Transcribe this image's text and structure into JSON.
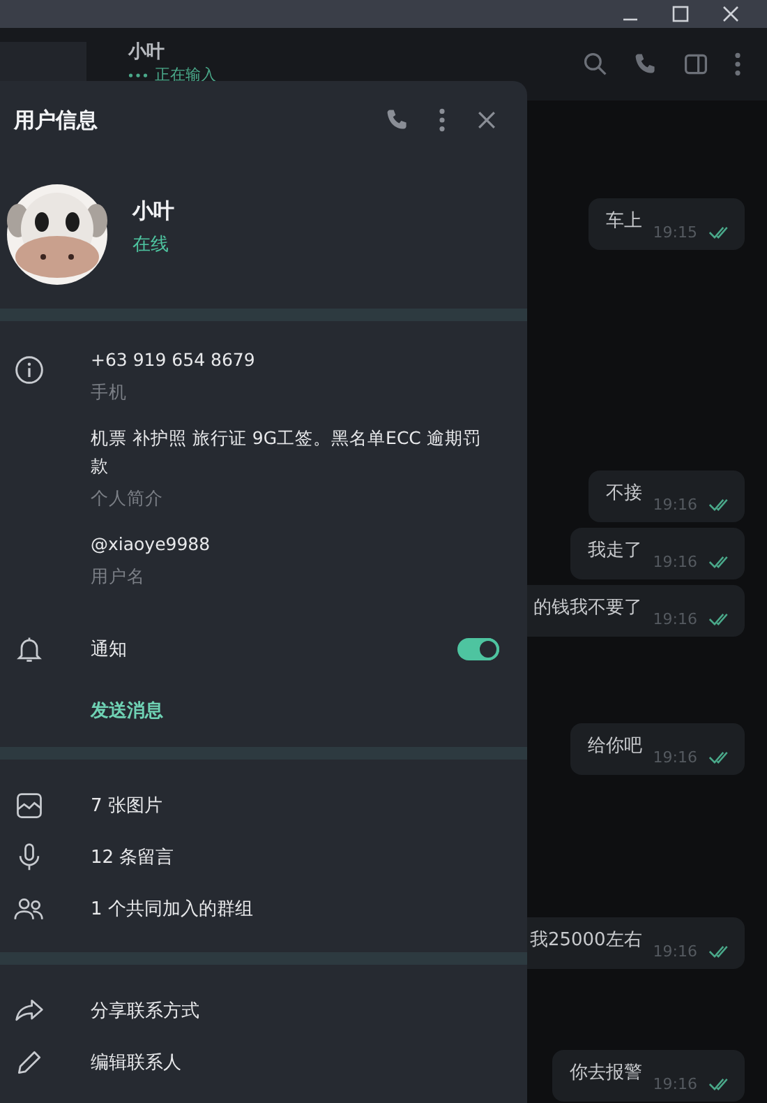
{
  "chat_header": {
    "name": "小叶",
    "status": "正在输入"
  },
  "messages": [
    {
      "text": "车上",
      "time": "19:15",
      "read": true
    },
    {
      "text": "不接",
      "time": "19:16",
      "read": true
    },
    {
      "text": "我走了",
      "time": "19:16",
      "read": true
    },
    {
      "text": "的钱我不要了",
      "time": "19:16",
      "read": true
    },
    {
      "text": "给你吧",
      "time": "19:16",
      "read": true
    },
    {
      "text": "我25000左右",
      "time": "19:16",
      "read": true
    },
    {
      "text": "你去报警",
      "time": "19:16",
      "read": true
    }
  ],
  "panel": {
    "title": "用户信息",
    "name": "小叶",
    "status": "在线",
    "info": [
      {
        "value": "+63 919 654 8679",
        "label": "手机"
      },
      {
        "value": "机票 补护照 旅行证 9G工签。黑名单ECC 逾期罚款",
        "label": "个人简介"
      },
      {
        "value": "@xiaoye9988",
        "label": "用户名"
      }
    ],
    "notifications": {
      "label": "通知",
      "on": true
    },
    "send_message": "发送消息",
    "media": [
      {
        "kind": "photos",
        "text": "7 张图片"
      },
      {
        "kind": "voice",
        "text": "12 条留言"
      },
      {
        "kind": "groups",
        "text": "1 个共同加入的群组"
      }
    ],
    "actions": [
      {
        "kind": "share",
        "text": "分享联系方式"
      },
      {
        "kind": "edit",
        "text": "编辑联系人"
      }
    ]
  }
}
